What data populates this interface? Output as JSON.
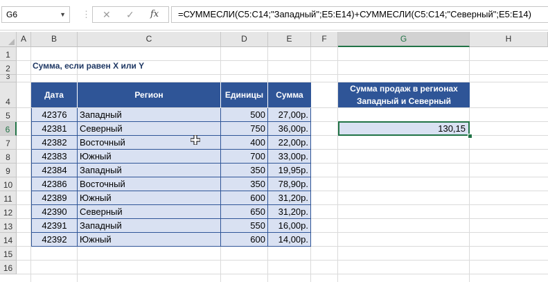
{
  "formula_bar": {
    "name_box": "G6",
    "cancel_icon": "✕",
    "enter_icon": "✓",
    "fx_label": "fx",
    "formula": "=СУММЕСЛИ(C5:C14;\"Западный\";E5:E14)+СУММЕСЛИ(C5:C14;\"Северный\";E5:E14)"
  },
  "columns": [
    "A",
    "B",
    "C",
    "D",
    "E",
    "F",
    "G",
    "H"
  ],
  "rows": [
    "1",
    "2",
    "3",
    "4",
    "5",
    "6",
    "7",
    "8",
    "9",
    "10",
    "11",
    "12",
    "13",
    "14",
    "15",
    "16"
  ],
  "selection": {
    "column": "G",
    "row": "6"
  },
  "sheet": {
    "title": "Сумма, если равен X или Y",
    "table": {
      "headers": {
        "date": "Дата",
        "region": "Регион",
        "units": "Единицы",
        "sum": "Сумма"
      },
      "rows": [
        {
          "date": "42376",
          "region": "Западный",
          "units": "500",
          "sum": "27,00р."
        },
        {
          "date": "42381",
          "region": "Северный",
          "units": "750",
          "sum": "36,00р."
        },
        {
          "date": "42382",
          "region": "Восточный",
          "units": "400",
          "sum": "22,00р."
        },
        {
          "date": "42383",
          "region": "Южный",
          "units": "700",
          "sum": "33,00р."
        },
        {
          "date": "42384",
          "region": "Западный",
          "units": "350",
          "sum": "19,95р."
        },
        {
          "date": "42386",
          "region": "Восточный",
          "units": "350",
          "sum": "78,90р."
        },
        {
          "date": "42389",
          "region": "Южный",
          "units": "600",
          "sum": "31,20р."
        },
        {
          "date": "42390",
          "region": "Северный",
          "units": "650",
          "sum": "31,20р."
        },
        {
          "date": "42391",
          "region": "Западный",
          "units": "550",
          "sum": "16,00р."
        },
        {
          "date": "42392",
          "region": "Южный",
          "units": "600",
          "sum": "14,00р."
        }
      ]
    },
    "result": {
      "header_line1": "Сумма продаж в регионах",
      "header_line2": "Западный и Северный",
      "value": "130,15"
    }
  },
  "colors": {
    "header_fill": "#2f5597",
    "cell_fill": "#d9e1f2",
    "selection": "#217346"
  }
}
